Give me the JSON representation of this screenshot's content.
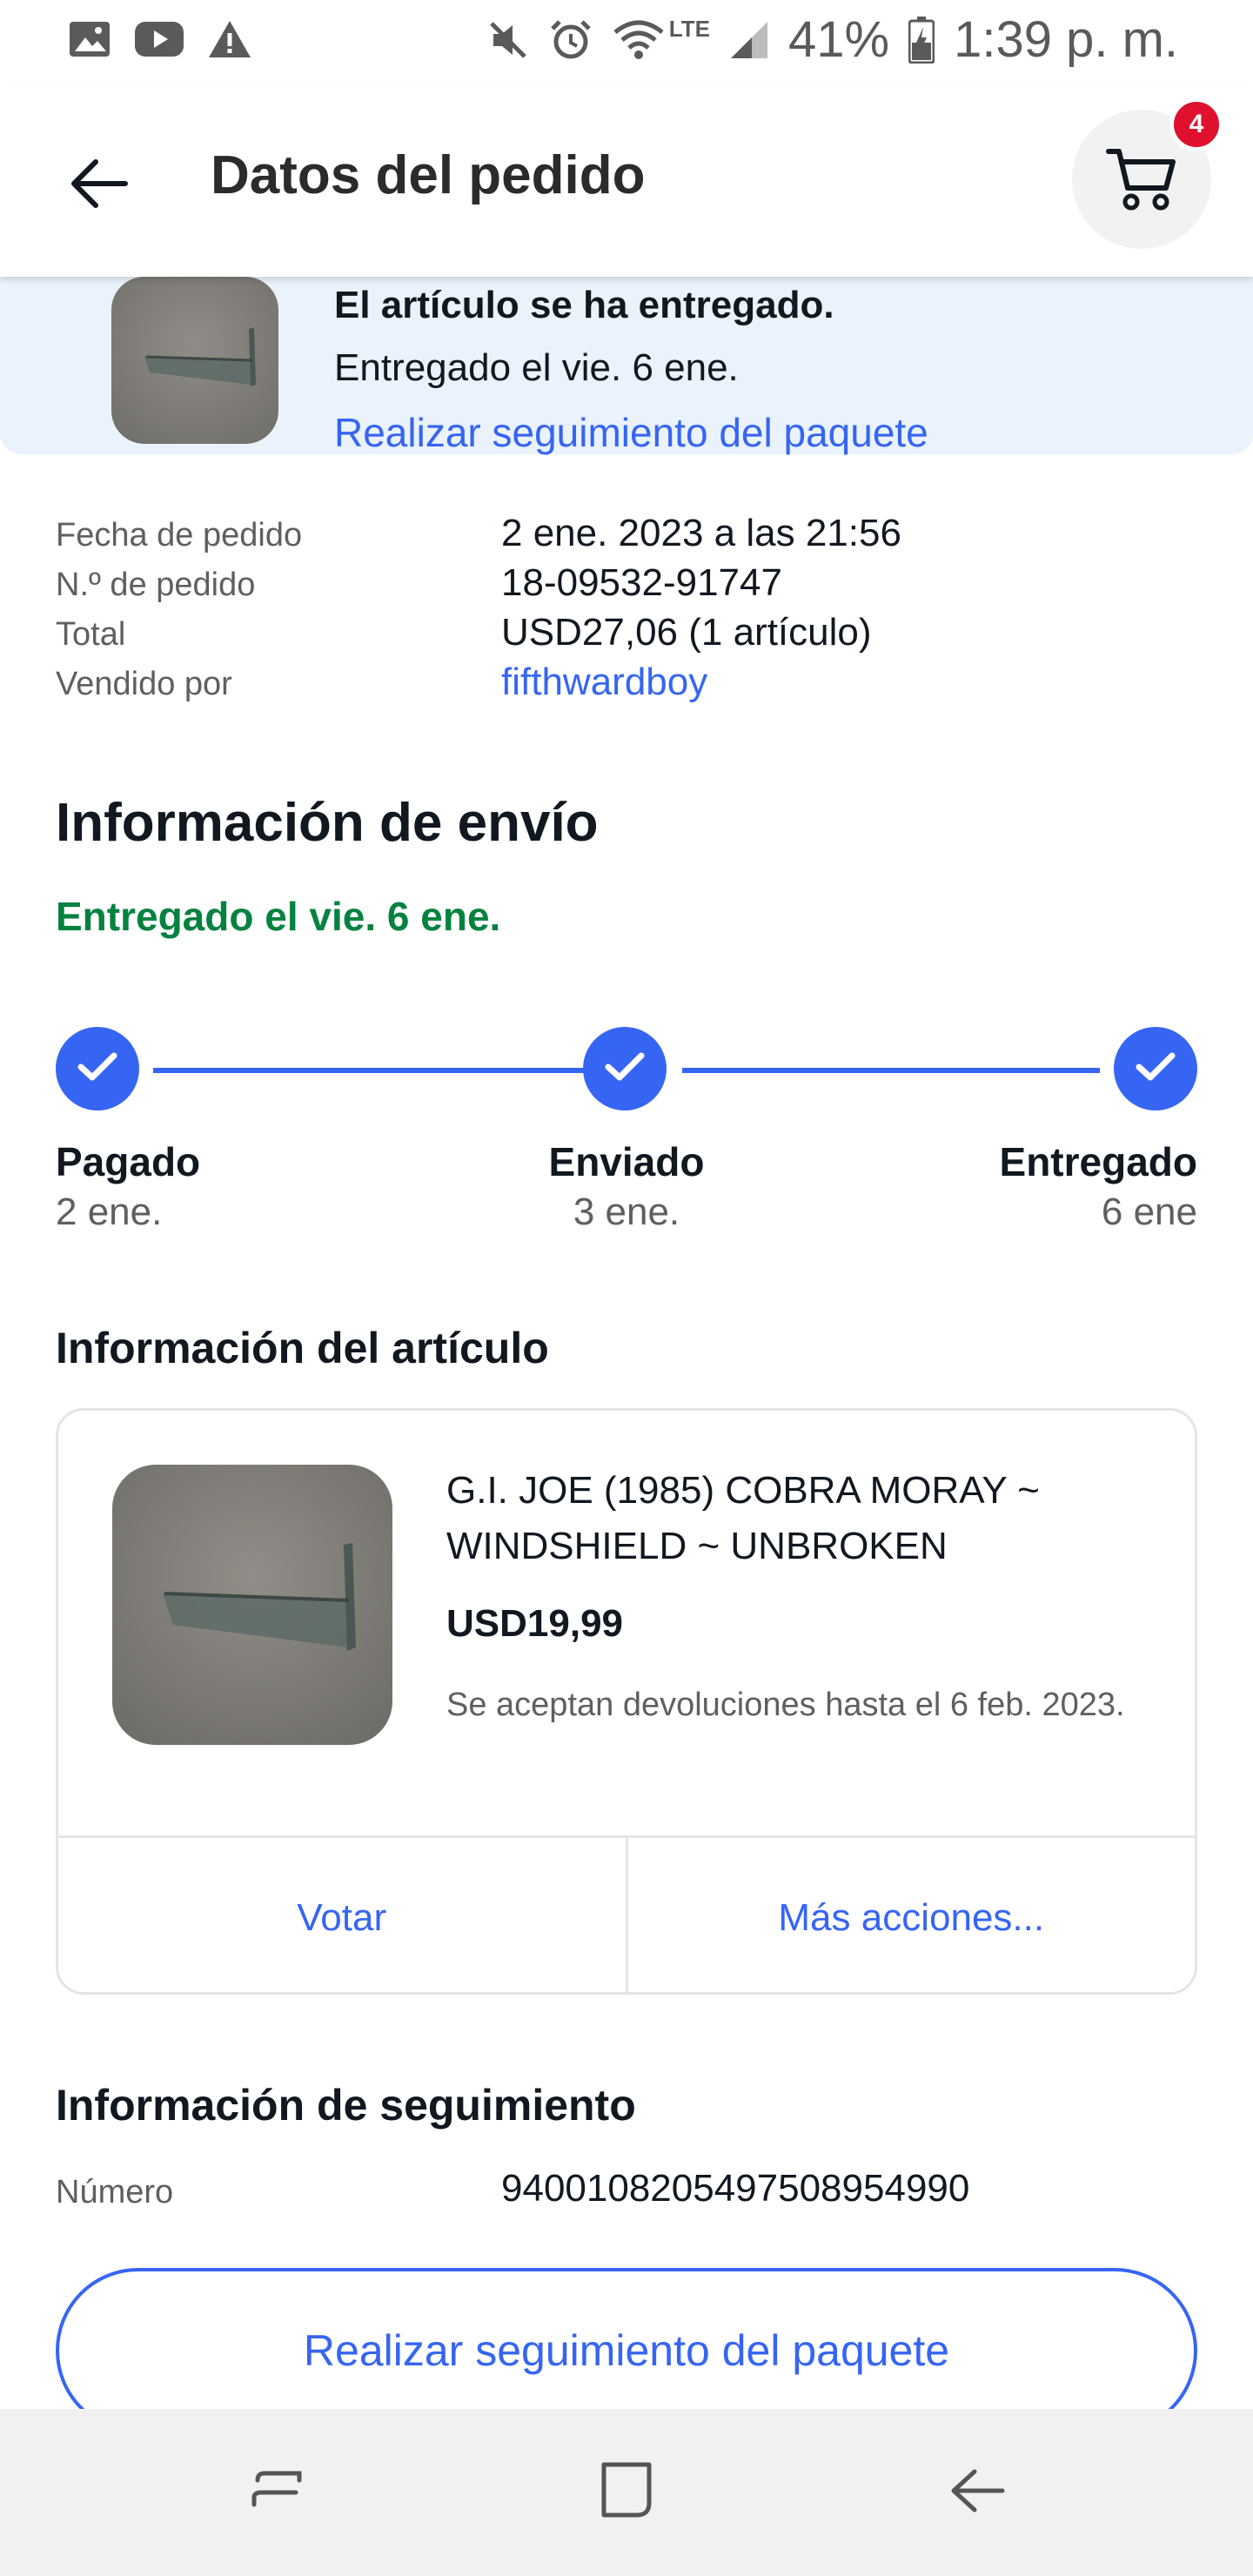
{
  "status_bar": {
    "battery": "41%",
    "time": "1:39 p. m.",
    "network": "LTE"
  },
  "header": {
    "title": "Datos del pedido",
    "cart_count": "4"
  },
  "banner": {
    "title": "El artículo se ha entregado.",
    "subtitle": "Entregado el vie. 6 ene.",
    "link": "Realizar seguimiento del paquete"
  },
  "order": {
    "rows": [
      {
        "label": "Fecha de pedido",
        "value": "2 ene. 2023 a las 21:56"
      },
      {
        "label": "N.º de pedido",
        "value": "18-09532-91747"
      },
      {
        "label": "Total",
        "value": "USD27,06 (1 artículo)"
      },
      {
        "label": "Vendido por",
        "value": "fifthwardboy"
      }
    ]
  },
  "shipping": {
    "title": "Información de envío",
    "status": "Entregado el vie. 6 ene.",
    "steps": [
      {
        "label": "Pagado",
        "date": "2 ene."
      },
      {
        "label": "Enviado",
        "date": "3 ene."
      },
      {
        "label": "Entregado",
        "date": "6 ene"
      }
    ]
  },
  "item": {
    "section_title": "Información del artículo",
    "name": "G.I. JOE (1985) COBRA MORAY ~ WINDSHIELD ~ UNBROKEN",
    "price": "USD19,99",
    "returns": "Se aceptan devoluciones hasta el 6 feb. 2023.",
    "action_vote": "Votar",
    "action_more": "Más acciones..."
  },
  "tracking": {
    "title": "Información de seguimiento",
    "label": "Número",
    "number": "9400108205497508954990",
    "button": "Realizar seguimiento del paquete"
  },
  "colors": {
    "accent": "#3665f3",
    "success": "#05823f",
    "badge": "#e0102f",
    "banner_bg": "#eaf2fc"
  }
}
